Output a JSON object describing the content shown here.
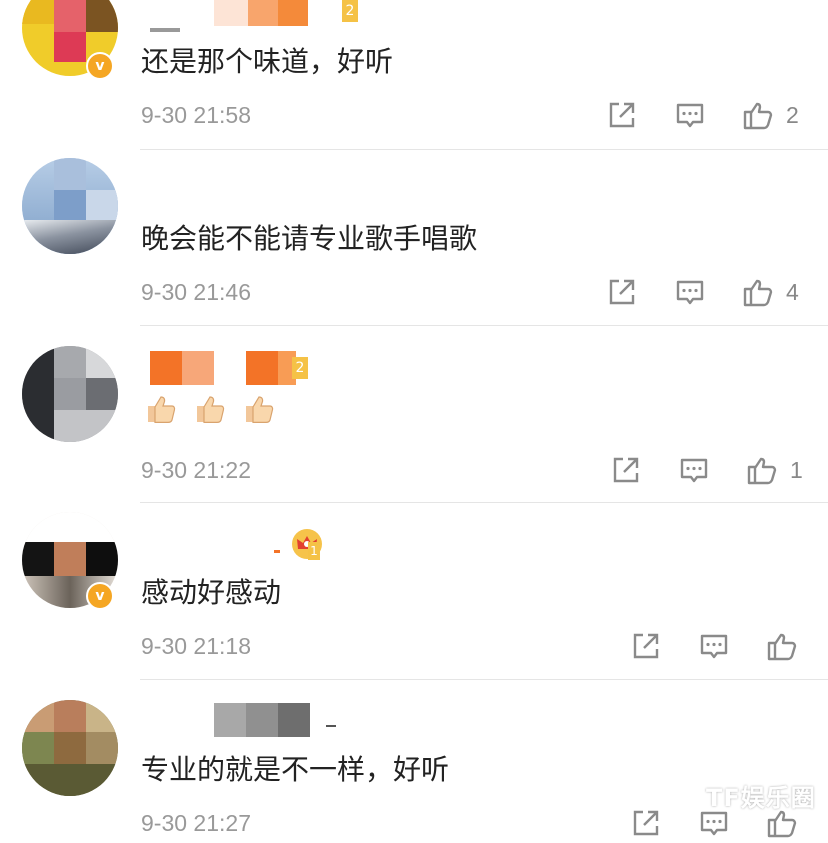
{
  "comments": [
    {
      "text": "还是那个味道，好听",
      "time": "9-30 21:58",
      "likes": "2"
    },
    {
      "text": "晚会能不能请专业歌手唱歌",
      "time": "9-30 21:46",
      "likes": "4"
    },
    {
      "text": "",
      "time": "9-30 21:22",
      "likes": "1",
      "emoji": [
        "thumbs-up",
        "thumbs-up",
        "thumbs-up"
      ]
    },
    {
      "text": "感动好感动",
      "time": "9-30 21:18",
      "likes": ""
    },
    {
      "text": "专业的就是不一样，好听",
      "time": "9-30 21:27",
      "likes": ""
    }
  ],
  "badges": {
    "verified": "v",
    "level_2": "2",
    "level_1": "1"
  },
  "watermark": "TF娱乐圈",
  "colors": {
    "divider": "#e5e5e5",
    "meta": "#999999",
    "text": "#222222",
    "verified": "#f5a623",
    "icon": "#8a8a8a"
  }
}
